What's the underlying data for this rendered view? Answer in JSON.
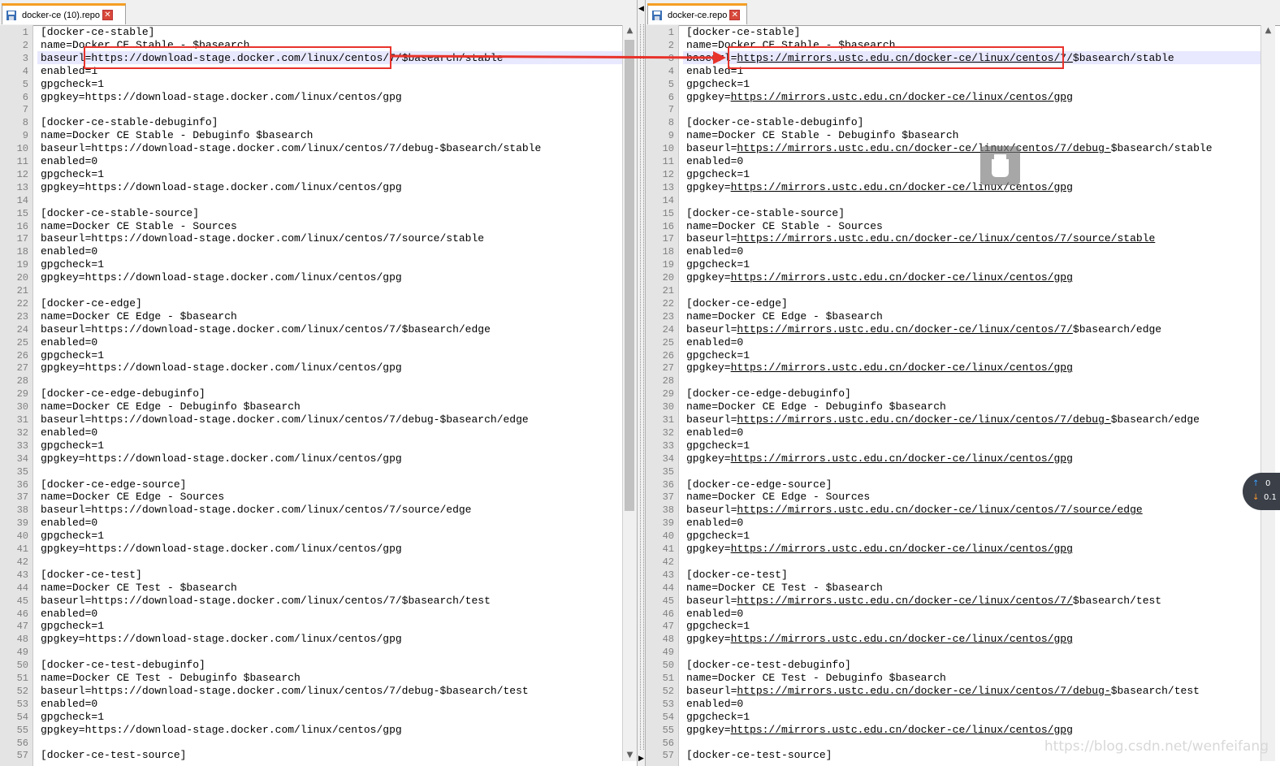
{
  "left": {
    "tab_title": "docker-ce (10).repo",
    "lines": [
      "[docker-ce-stable]",
      "name=Docker CE Stable - $basearch",
      "baseurl=https://download-stage.docker.com/linux/centos/7/$basearch/stable",
      "enabled=1",
      "gpgcheck=1",
      "gpgkey=https://download-stage.docker.com/linux/centos/gpg",
      "",
      "[docker-ce-stable-debuginfo]",
      "name=Docker CE Stable - Debuginfo $basearch",
      "baseurl=https://download-stage.docker.com/linux/centos/7/debug-$basearch/stable",
      "enabled=0",
      "gpgcheck=1",
      "gpgkey=https://download-stage.docker.com/linux/centos/gpg",
      "",
      "[docker-ce-stable-source]",
      "name=Docker CE Stable - Sources",
      "baseurl=https://download-stage.docker.com/linux/centos/7/source/stable",
      "enabled=0",
      "gpgcheck=1",
      "gpgkey=https://download-stage.docker.com/linux/centos/gpg",
      "",
      "[docker-ce-edge]",
      "name=Docker CE Edge - $basearch",
      "baseurl=https://download-stage.docker.com/linux/centos/7/$basearch/edge",
      "enabled=0",
      "gpgcheck=1",
      "gpgkey=https://download-stage.docker.com/linux/centos/gpg",
      "",
      "[docker-ce-edge-debuginfo]",
      "name=Docker CE Edge - Debuginfo $basearch",
      "baseurl=https://download-stage.docker.com/linux/centos/7/debug-$basearch/edge",
      "enabled=0",
      "gpgcheck=1",
      "gpgkey=https://download-stage.docker.com/linux/centos/gpg",
      "",
      "[docker-ce-edge-source]",
      "name=Docker CE Edge - Sources",
      "baseurl=https://download-stage.docker.com/linux/centos/7/source/edge",
      "enabled=0",
      "gpgcheck=1",
      "gpgkey=https://download-stage.docker.com/linux/centos/gpg",
      "",
      "[docker-ce-test]",
      "name=Docker CE Test - $basearch",
      "baseurl=https://download-stage.docker.com/linux/centos/7/$basearch/test",
      "enabled=0",
      "gpgcheck=1",
      "gpgkey=https://download-stage.docker.com/linux/centos/gpg",
      "",
      "[docker-ce-test-debuginfo]",
      "name=Docker CE Test - Debuginfo $basearch",
      "baseurl=https://download-stage.docker.com/linux/centos/7/debug-$basearch/test",
      "enabled=0",
      "gpgcheck=1",
      "gpgkey=https://download-stage.docker.com/linux/centos/gpg",
      "",
      "[docker-ce-test-source]"
    ]
  },
  "right": {
    "tab_title": "docker-ce.repo",
    "lines": [
      "[docker-ce-stable]",
      "name=Docker CE Stable - $basearch",
      "baseurl=https://mirrors.ustc.edu.cn/docker-ce/linux/centos/7/$basearch/stable",
      "enabled=1",
      "gpgcheck=1",
      "gpgkey=https://mirrors.ustc.edu.cn/docker-ce/linux/centos/gpg",
      "",
      "[docker-ce-stable-debuginfo]",
      "name=Docker CE Stable - Debuginfo $basearch",
      "baseurl=https://mirrors.ustc.edu.cn/docker-ce/linux/centos/7/debug-$basearch/stable",
      "enabled=0",
      "gpgcheck=1",
      "gpgkey=https://mirrors.ustc.edu.cn/docker-ce/linux/centos/gpg",
      "",
      "[docker-ce-stable-source]",
      "name=Docker CE Stable - Sources",
      "baseurl=https://mirrors.ustc.edu.cn/docker-ce/linux/centos/7/source/stable",
      "enabled=0",
      "gpgcheck=1",
      "gpgkey=https://mirrors.ustc.edu.cn/docker-ce/linux/centos/gpg",
      "",
      "[docker-ce-edge]",
      "name=Docker CE Edge - $basearch",
      "baseurl=https://mirrors.ustc.edu.cn/docker-ce/linux/centos/7/$basearch/edge",
      "enabled=0",
      "gpgcheck=1",
      "gpgkey=https://mirrors.ustc.edu.cn/docker-ce/linux/centos/gpg",
      "",
      "[docker-ce-edge-debuginfo]",
      "name=Docker CE Edge - Debuginfo $basearch",
      "baseurl=https://mirrors.ustc.edu.cn/docker-ce/linux/centos/7/debug-$basearch/edge",
      "enabled=0",
      "gpgcheck=1",
      "gpgkey=https://mirrors.ustc.edu.cn/docker-ce/linux/centos/gpg",
      "",
      "[docker-ce-edge-source]",
      "name=Docker CE Edge - Sources",
      "baseurl=https://mirrors.ustc.edu.cn/docker-ce/linux/centos/7/source/edge",
      "enabled=0",
      "gpgcheck=1",
      "gpgkey=https://mirrors.ustc.edu.cn/docker-ce/linux/centos/gpg",
      "",
      "[docker-ce-test]",
      "name=Docker CE Test - $basearch",
      "baseurl=https://mirrors.ustc.edu.cn/docker-ce/linux/centos/7/$basearch/test",
      "enabled=0",
      "gpgcheck=1",
      "gpgkey=https://mirrors.ustc.edu.cn/docker-ce/linux/centos/gpg",
      "",
      "[docker-ce-test-debuginfo]",
      "name=Docker CE Test - Debuginfo $basearch",
      "baseurl=https://mirrors.ustc.edu.cn/docker-ce/linux/centos/7/debug-$basearch/test",
      "enabled=0",
      "gpgcheck=1",
      "gpgkey=https://mirrors.ustc.edu.cn/docker-ce/linux/centos/gpg",
      "",
      "[docker-ce-test-source]"
    ]
  },
  "current_line": 3,
  "net_widget": {
    "row1": "0",
    "row2": "0.1"
  },
  "watermark": "https://blog.csdn.net/wenfeifang",
  "colors": {
    "annotation_red": "#e8332b",
    "tab_accent": "#f59e22",
    "current_line_bg": "#e8e8ff"
  }
}
